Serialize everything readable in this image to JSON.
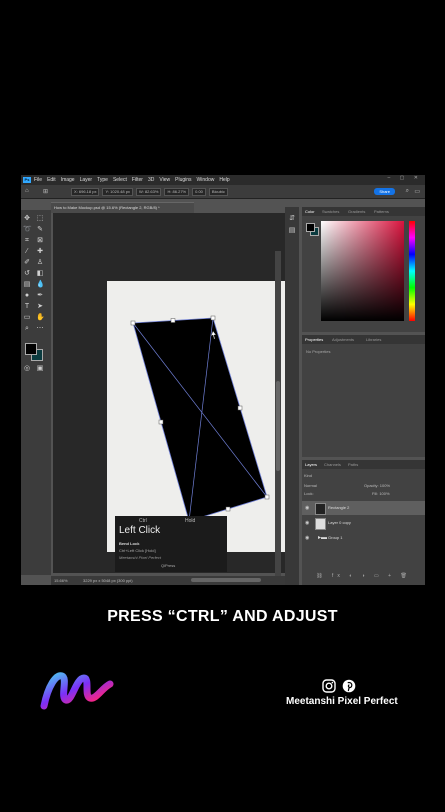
{
  "menu": {
    "logo": "Ps",
    "items": [
      "File",
      "Edit",
      "Image",
      "Layer",
      "Type",
      "Select",
      "Filter",
      "3D",
      "View",
      "Plugins",
      "Window",
      "Help"
    ],
    "window_controls": "– ▢ ✕"
  },
  "options_bar": {
    "x_value": "X: 696.18 px",
    "y_value": "Y: 1020.48 px",
    "w_value": "W: 82.63%",
    "h_value": "H: 86.27%",
    "angle_value": "0.00",
    "interpolation": "Bicubic",
    "share_label": "Share"
  },
  "document": {
    "tab_title": "How to Make Mockup.psd @ 15.6% (Rectangle 2, RGB/8) *",
    "status_zoom": "15.66%",
    "status_info": "3229 px x 5048 px (300 ppi)"
  },
  "context_tooltip": {
    "header_left": "Ctrl",
    "header_right": "Hold",
    "title": "Left Click",
    "line1": "Bend Lock",
    "line2": "Ctrl+Left Click [Hold]",
    "line3": "Meetanshi Pixel Perfect",
    "line4": "QiPress"
  },
  "color_panel": {
    "tabs": [
      "Color",
      "Swatches",
      "Gradients",
      "Patterns"
    ]
  },
  "properties_panel": {
    "tabs": [
      "Properties",
      "Adjustments",
      "Libraries"
    ],
    "empty_text": "No Properties"
  },
  "layers_panel": {
    "tabs": [
      "Layers",
      "Channels",
      "Paths"
    ],
    "kind_label": "Kind",
    "blend_mode": "Normal",
    "opacity_label": "Opacity: 100%",
    "lock_label": "Lock:",
    "fill_label": "Fill: 100%",
    "layers": [
      {
        "name": "Rectangle 2"
      },
      {
        "name": "Layer 0 copy"
      },
      {
        "name": "Group 1"
      }
    ],
    "footer_icons": "⛓ fx ◐ ◑ ▭ + 🗑"
  },
  "caption": "PRESS “CTRL” AND ADJUST",
  "brand": {
    "name": "Meetanshi Pixel Perfect",
    "logo_colors": [
      "#7b2ff7",
      "#f72585",
      "#4cc9f0",
      "#f9c74f"
    ]
  }
}
